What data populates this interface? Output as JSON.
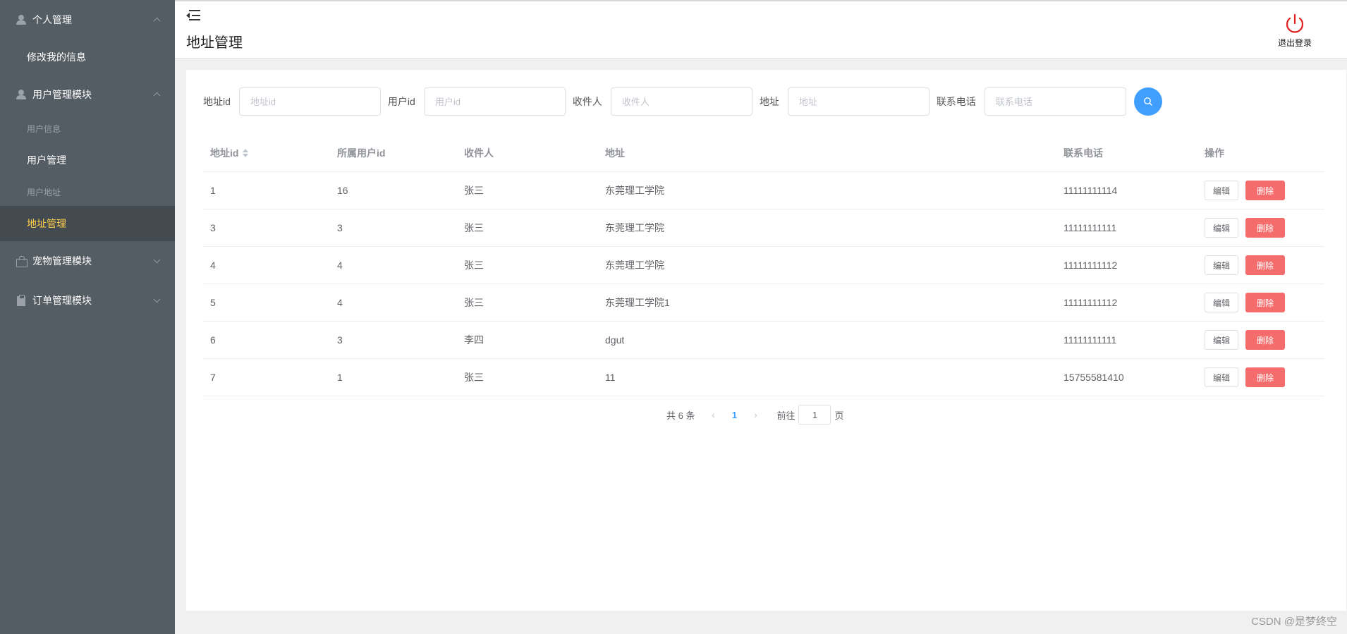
{
  "sidebar": {
    "groups": [
      {
        "title": "个人管理",
        "icon": "user-icon",
        "expanded": true,
        "items": [
          {
            "label": "修改我的信息"
          }
        ]
      },
      {
        "title": "用户管理模块",
        "icon": "user-icon",
        "expanded": true,
        "items": [
          {
            "label": "用户信息"
          },
          {
            "label": "用户管理"
          },
          {
            "label": "用户地址"
          },
          {
            "label": "地址管理",
            "active": true
          }
        ]
      },
      {
        "title": "宠物管理模块",
        "icon": "bag-icon",
        "expanded": false,
        "items": []
      },
      {
        "title": "订单管理模块",
        "icon": "clipboard-icon",
        "expanded": false,
        "items": []
      }
    ]
  },
  "header": {
    "title": "地址管理",
    "logout_label": "退出登录",
    "logout_color": "#e02020"
  },
  "filters": [
    {
      "label": "地址id",
      "placeholder": "地址id",
      "value": ""
    },
    {
      "label": "用户id",
      "placeholder": "用户id",
      "value": ""
    },
    {
      "label": "收件人",
      "placeholder": "收件人",
      "value": ""
    },
    {
      "label": "地址",
      "placeholder": "地址",
      "value": ""
    },
    {
      "label": "联系电话",
      "placeholder": "联系电话",
      "value": ""
    }
  ],
  "table": {
    "columns": [
      "地址id",
      "所属用户id",
      "收件人",
      "地址",
      "联系电话",
      "操作"
    ],
    "rows": [
      [
        "1",
        "16",
        "张三",
        "东莞理工学院",
        "11111111114"
      ],
      [
        "3",
        "3",
        "张三",
        "东莞理工学院",
        "11111111111"
      ],
      [
        "4",
        "4",
        "张三",
        "东莞理工学院",
        "11111111112"
      ],
      [
        "5",
        "4",
        "张三",
        "东莞理工学院1",
        "11111111112"
      ],
      [
        "6",
        "3",
        "李四",
        "dgut",
        "11111111111"
      ],
      [
        "7",
        "1",
        "张三",
        "11",
        "15755581410"
      ]
    ],
    "edit_label": "编辑",
    "delete_label": "删除"
  },
  "pagination": {
    "total_text": "共 6 条",
    "current_page": "1",
    "goto_prefix": "前往",
    "goto_value": "1",
    "goto_suffix": "页"
  },
  "watermark": "CSDN @是梦终空",
  "colors": {
    "sidebar_bg": "#545c64",
    "active_text": "#ffd04b",
    "primary": "#409eff",
    "danger": "#f56c6c"
  }
}
